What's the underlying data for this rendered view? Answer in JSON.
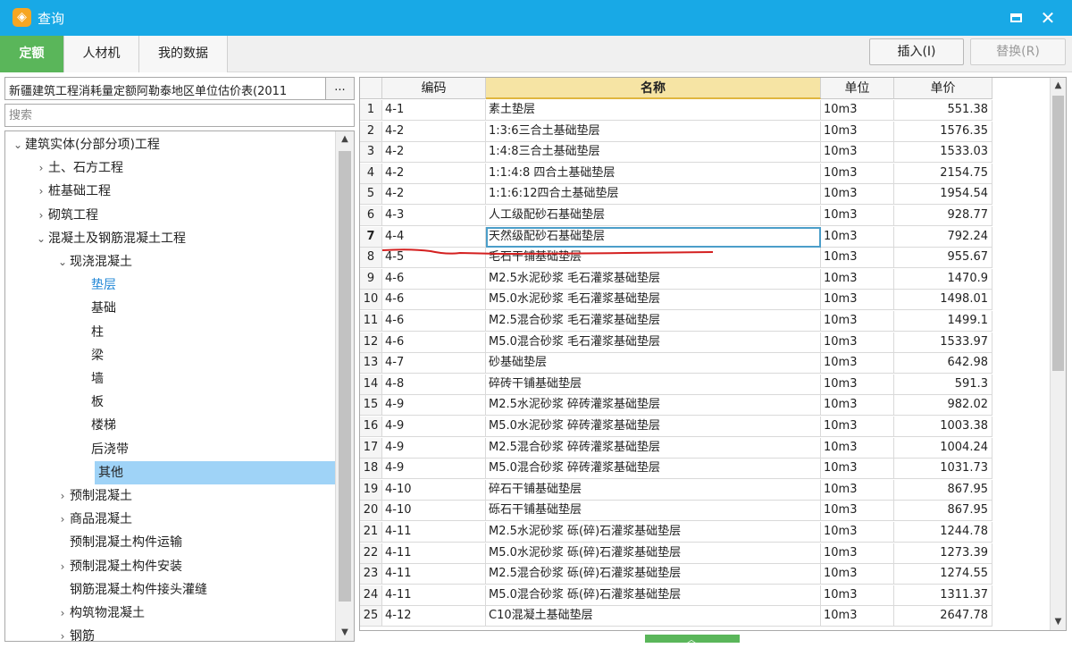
{
  "window": {
    "title": "查询",
    "app_icon": "app-logo-icon"
  },
  "tabs": [
    {
      "label": "定额",
      "active": true
    },
    {
      "label": "人材机",
      "active": false
    },
    {
      "label": "我的数据",
      "active": false
    }
  ],
  "toolbar": {
    "insert_label": "插入(I)",
    "replace_label": "替换(R)"
  },
  "library": {
    "name": "新疆建筑工程消耗量定额阿勒泰地区单位估价表(2011",
    "browse_label": "..."
  },
  "search": {
    "placeholder": "搜索",
    "value": ""
  },
  "tree": [
    {
      "label": "建筑实体(分部分项)工程",
      "arrow": "expanded"
    },
    {
      "label": "土、石方工程",
      "arrow": "collapsed"
    },
    {
      "label": "桩基础工程",
      "arrow": "collapsed"
    },
    {
      "label": "砌筑工程",
      "arrow": "collapsed"
    },
    {
      "label": "混凝土及钢筋混凝土工程",
      "arrow": "expanded"
    },
    {
      "label": "现浇混凝土",
      "arrow": "expanded"
    },
    {
      "label": "垫层",
      "arrow": "none",
      "link": true
    },
    {
      "label": "基础",
      "arrow": "none"
    },
    {
      "label": "柱",
      "arrow": "none"
    },
    {
      "label": "梁",
      "arrow": "none"
    },
    {
      "label": "墙",
      "arrow": "none"
    },
    {
      "label": "板",
      "arrow": "none"
    },
    {
      "label": "楼梯",
      "arrow": "none"
    },
    {
      "label": "后浇带",
      "arrow": "none"
    },
    {
      "label": "其他",
      "arrow": "none",
      "selected": true
    },
    {
      "label": "预制混凝土",
      "arrow": "collapsed"
    },
    {
      "label": "商品混凝土",
      "arrow": "collapsed"
    },
    {
      "label": "预制混凝土构件运输",
      "arrow": "none"
    },
    {
      "label": "预制混凝土构件安装",
      "arrow": "collapsed"
    },
    {
      "label": "钢筋混凝土构件接头灌缝",
      "arrow": "none"
    },
    {
      "label": "构筑物混凝土",
      "arrow": "collapsed"
    },
    {
      "label": "钢筋",
      "arrow": "collapsed"
    }
  ],
  "grid": {
    "columns": [
      "编码",
      "名称",
      "单位",
      "单价"
    ],
    "active_column": 1,
    "current_row": 7,
    "rows": [
      [
        "1",
        "4-1",
        "素土垫层",
        "10m3",
        "551.38"
      ],
      [
        "2",
        "4-2",
        "1:3:6三合土基础垫层",
        "10m3",
        "1576.35"
      ],
      [
        "3",
        "4-2",
        "1:4:8三合土基础垫层",
        "10m3",
        "1533.03"
      ],
      [
        "4",
        "4-2",
        "1:1:4:8 四合土基础垫层",
        "10m3",
        "2154.75"
      ],
      [
        "5",
        "4-2",
        "1:1:6:12四合土基础垫层",
        "10m3",
        "1954.54"
      ],
      [
        "6",
        "4-3",
        "人工级配砂石基础垫层",
        "10m3",
        "928.77"
      ],
      [
        "7",
        "4-4",
        "天然级配砂石基础垫层",
        "10m3",
        "792.24"
      ],
      [
        "8",
        "4-5",
        "毛石干铺基础垫层",
        "10m3",
        "955.67"
      ],
      [
        "9",
        "4-6",
        "M2.5水泥砂浆 毛石灌浆基础垫层",
        "10m3",
        "1470.9"
      ],
      [
        "10",
        "4-6",
        "M5.0水泥砂浆 毛石灌浆基础垫层",
        "10m3",
        "1498.01"
      ],
      [
        "11",
        "4-6",
        "M2.5混合砂浆 毛石灌浆基础垫层",
        "10m3",
        "1499.1"
      ],
      [
        "12",
        "4-6",
        "M5.0混合砂浆 毛石灌浆基础垫层",
        "10m3",
        "1533.97"
      ],
      [
        "13",
        "4-7",
        "砂基础垫层",
        "10m3",
        "642.98"
      ],
      [
        "14",
        "4-8",
        "碎砖干铺基础垫层",
        "10m3",
        "591.3"
      ],
      [
        "15",
        "4-9",
        "M2.5水泥砂浆 碎砖灌浆基础垫层",
        "10m3",
        "982.02"
      ],
      [
        "16",
        "4-9",
        "M5.0水泥砂浆 碎砖灌浆基础垫层",
        "10m3",
        "1003.38"
      ],
      [
        "17",
        "4-9",
        "M2.5混合砂浆 碎砖灌浆基础垫层",
        "10m3",
        "1004.24"
      ],
      [
        "18",
        "4-9",
        "M5.0混合砂浆 碎砖灌浆基础垫层",
        "10m3",
        "1031.73"
      ],
      [
        "19",
        "4-10",
        "碎石干铺基础垫层",
        "10m3",
        "867.95"
      ],
      [
        "20",
        "4-10",
        "砾石干铺基础垫层",
        "10m3",
        "867.95"
      ],
      [
        "21",
        "4-11",
        "M2.5水泥砂浆 砾(碎)石灌浆基础垫层",
        "10m3",
        "1244.78"
      ],
      [
        "22",
        "4-11",
        "M5.0水泥砂浆 砾(碎)石灌浆基础垫层",
        "10m3",
        "1273.39"
      ],
      [
        "23",
        "4-11",
        "M2.5混合砂浆 砾(碎)石灌浆基础垫层",
        "10m3",
        "1274.55"
      ],
      [
        "24",
        "4-11",
        "M5.0混合砂浆 砾(碎)石灌浆基础垫层",
        "10m3",
        "1311.37"
      ],
      [
        "25",
        "4-12",
        "C10混凝土基础垫层",
        "10m3",
        "2647.78"
      ]
    ]
  },
  "colors": {
    "titlebar": "#18a9e6",
    "active_tab": "#5ab65a",
    "selected_tree": "#9fd3f7",
    "annotation": "#d42020"
  }
}
